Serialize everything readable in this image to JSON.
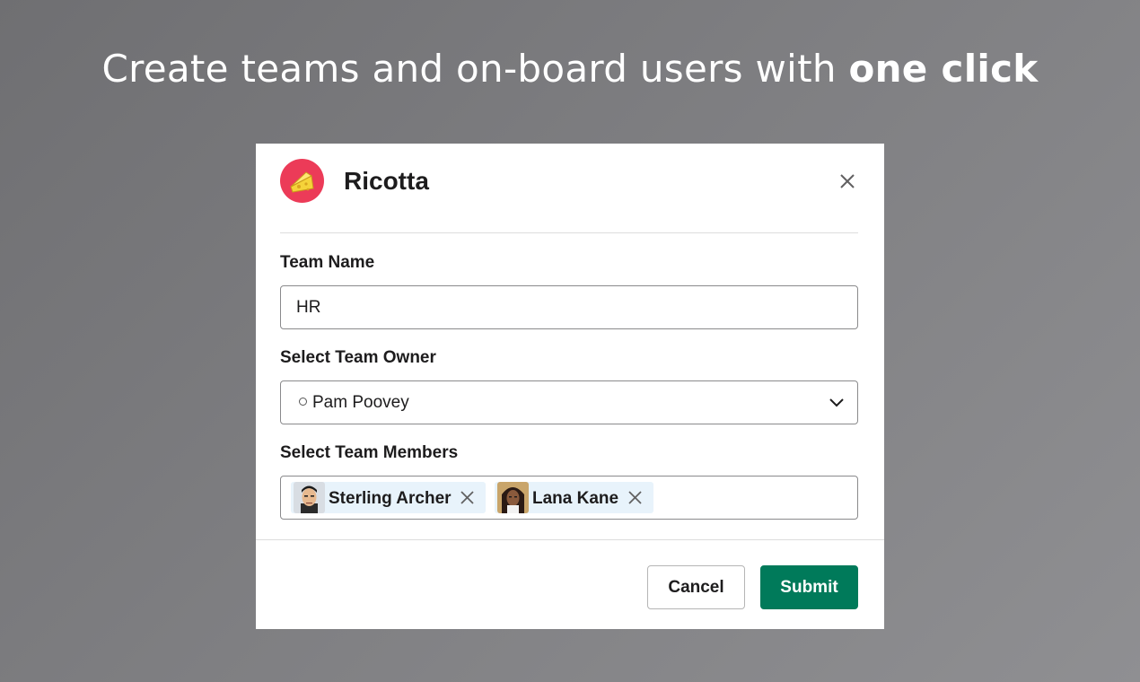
{
  "headline": {
    "text": "Create teams and on-board users with ",
    "bold": "one click"
  },
  "modal": {
    "app_name": "Ricotta",
    "logo_icon": "cheese-icon",
    "brand_color": "#ec3b58",
    "team_name": {
      "label": "Team Name",
      "value": "HR"
    },
    "team_owner": {
      "label": "Select Team Owner",
      "value": "Pam Poovey"
    },
    "team_members": {
      "label": "Select Team Members",
      "chips": [
        {
          "name": "Sterling Archer"
        },
        {
          "name": "Lana Kane"
        }
      ]
    },
    "cancel_label": "Cancel",
    "submit_label": "Submit",
    "submit_color": "#007a5a"
  }
}
